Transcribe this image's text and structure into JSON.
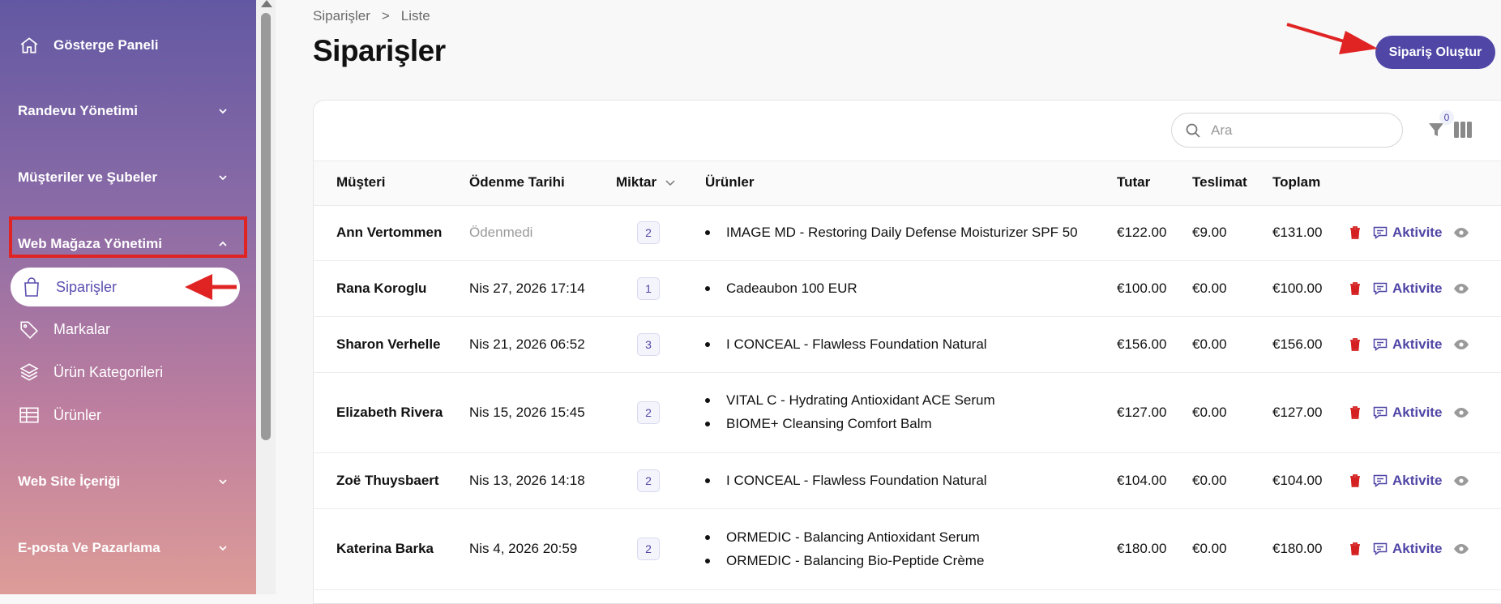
{
  "sidebar": {
    "dashboard": "Gösterge Paneli",
    "appointments": "Randevu Yönetimi",
    "customers": "Müşteriler ve Şubeler",
    "webshop": "Web Mağaza Yönetimi",
    "orders": "Siparişler",
    "brands": "Markalar",
    "categories": "Ürün Kategorileri",
    "products": "Ürünler",
    "website": "Web Site İçeriği",
    "email": "E-posta Ve Pazarlama"
  },
  "breadcrumb": {
    "parent": "Siparişler",
    "separator": ">",
    "current": "Liste"
  },
  "page": {
    "title": "Siparişler",
    "create_label": "Sipariş Oluştur"
  },
  "search": {
    "placeholder": "Ara"
  },
  "filter": {
    "count": "0"
  },
  "table": {
    "headers": {
      "customer": "Müşteri",
      "payment_date": "Ödenme Tarihi",
      "quantity": "Miktar",
      "products": "Ürünler",
      "amount": "Tutar",
      "shipping": "Teslimat",
      "total": "Toplam"
    },
    "activity_label": "Aktivite",
    "rows": [
      {
        "customer": "Ann Vertommen",
        "date": "Ödenmedi",
        "qty": "2",
        "products": [
          "IMAGE MD - Restoring Daily Defense Moisturizer SPF 50"
        ],
        "amount": "€122.00",
        "shipping": "€9.00",
        "total": "€131.00"
      },
      {
        "customer": "Rana Koroglu",
        "date": "Nis 27, 2026 17:14",
        "qty": "1",
        "products": [
          "Cadeaubon 100 EUR"
        ],
        "amount": "€100.00",
        "shipping": "€0.00",
        "total": "€100.00"
      },
      {
        "customer": "Sharon Verhelle",
        "date": "Nis 21, 2026 06:52",
        "qty": "3",
        "products": [
          "I CONCEAL - Flawless Foundation Natural"
        ],
        "amount": "€156.00",
        "shipping": "€0.00",
        "total": "€156.00"
      },
      {
        "customer": "Elizabeth Rivera",
        "date": "Nis 15, 2026 15:45",
        "qty": "2",
        "products": [
          "VITAL C - Hydrating Antioxidant ACE Serum",
          "BIOME+ Cleansing Comfort Balm"
        ],
        "amount": "€127.00",
        "shipping": "€0.00",
        "total": "€127.00"
      },
      {
        "customer": "Zoë Thuysbaert",
        "date": "Nis 13, 2026 14:18",
        "qty": "2",
        "products": [
          "I CONCEAL - Flawless Foundation Natural"
        ],
        "amount": "€104.00",
        "shipping": "€0.00",
        "total": "€104.00"
      },
      {
        "customer": "Katerina Barka",
        "date": "Nis 4, 2026 20:59",
        "qty": "2",
        "products": [
          "ORMEDIC - Balancing Antioxidant Serum",
          "ORMEDIC - Balancing Bio-Peptide Crème"
        ],
        "amount": "€180.00",
        "shipping": "€0.00",
        "total": "€180.00"
      }
    ]
  },
  "colors": {
    "accent": "#4f46a6",
    "delete": "#d42020",
    "annotation": "#e02424"
  }
}
